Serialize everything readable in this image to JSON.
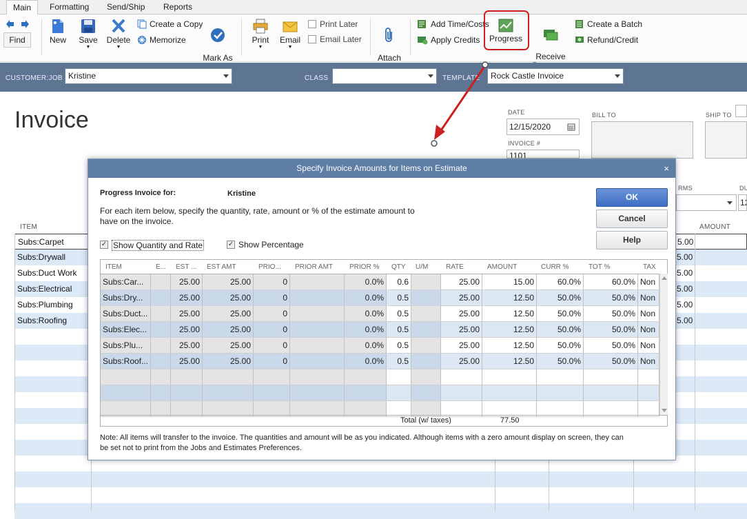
{
  "tabs": [
    "Main",
    "Formatting",
    "Send/Ship",
    "Reports"
  ],
  "ribbon": {
    "find": "Find",
    "new": "New",
    "save": "Save",
    "delete": "Delete",
    "create_copy": "Create a Copy",
    "memorize": "Memorize",
    "mark_as_pending": "Mark As\nPending",
    "print": "Print",
    "email": "Email",
    "print_later": "Print Later",
    "email_later": "Email Later",
    "attach_file": "Attach\nFile",
    "add_time_costs": "Add Time/Costs",
    "apply_credits": "Apply Credits",
    "progress": "Progress",
    "receive_payments": "Receive\nPayments",
    "create_batch": "Create a Batch",
    "refund_credit": "Refund/Credit"
  },
  "header": {
    "customer_job_label": "CUSTOMER:JOB",
    "customer_job_value": "Kristine",
    "class_label": "CLASS",
    "class_value": "",
    "template_label": "TEMPLATE",
    "template_value": "Rock Castle Invoice"
  },
  "invoice": {
    "title": "Invoice",
    "date_label": "DATE",
    "date_value": "12/15/2020",
    "invoice_no_label": "INVOICE #",
    "invoice_no_value": "1101",
    "bill_to_label": "BILL TO",
    "ship_to_label": "SHIP TO",
    "terms_label": "RMS",
    "due_label": "DU",
    "due_value": "12",
    "item_col": "ITEM",
    "amount_col": "AMOUNT",
    "lines": [
      {
        "item": "Subs:Carpet",
        "amount": "5.00"
      },
      {
        "item": "Subs:Drywall",
        "amount": "5.00"
      },
      {
        "item": "Subs:Duct Work",
        "amount": "5.00"
      },
      {
        "item": "Subs:Electrical",
        "amount": "5.00"
      },
      {
        "item": "Subs:Plumbing",
        "amount": "5.00"
      },
      {
        "item": "Subs:Roofing",
        "amount": "5.00"
      }
    ]
  },
  "dialog": {
    "title": "Specify Invoice Amounts for Items on Estimate",
    "progress_for_label": "Progress Invoice for:",
    "customer": "Kristine",
    "instructions": "For each item below, specify the quantity, rate, amount or % of the estimate amount to have on the invoice.",
    "show_qty_rate": "Show Quantity and Rate",
    "show_pct": "Show Percentage",
    "ok": "OK",
    "cancel": "Cancel",
    "help": "Help",
    "columns": [
      "ITEM",
      "E...",
      "EST ...",
      "EST AMT",
      "PRIO...",
      "PRIOR AMT",
      "PRIOR %",
      "QTY",
      "U/M",
      "RATE",
      "AMOUNT",
      "CURR %",
      "TOT %",
      "TAX"
    ],
    "rows": [
      {
        "item": "Subs:Car...",
        "est_qty": "25.00",
        "est_amt": "25.00",
        "prior_qty": "0",
        "prior_pct": "0.0%",
        "qty": "0.6",
        "rate": "25.00",
        "amount": "15.00",
        "curr_pct": "60.0%",
        "tot_pct": "60.0%",
        "tax": "Non"
      },
      {
        "item": "Subs:Dry...",
        "est_qty": "25.00",
        "est_amt": "25.00",
        "prior_qty": "0",
        "prior_pct": "0.0%",
        "qty": "0.5",
        "rate": "25.00",
        "amount": "12.50",
        "curr_pct": "50.0%",
        "tot_pct": "50.0%",
        "tax": "Non"
      },
      {
        "item": "Subs:Duct...",
        "est_qty": "25.00",
        "est_amt": "25.00",
        "prior_qty": "0",
        "prior_pct": "0.0%",
        "qty": "0.5",
        "rate": "25.00",
        "amount": "12.50",
        "curr_pct": "50.0%",
        "tot_pct": "50.0%",
        "tax": "Non"
      },
      {
        "item": "Subs:Elec...",
        "est_qty": "25.00",
        "est_amt": "25.00",
        "prior_qty": "0",
        "prior_pct": "0.0%",
        "qty": "0.5",
        "rate": "25.00",
        "amount": "12.50",
        "curr_pct": "50.0%",
        "tot_pct": "50.0%",
        "tax": "Non"
      },
      {
        "item": "Subs:Plu...",
        "est_qty": "25.00",
        "est_amt": "25.00",
        "prior_qty": "0",
        "prior_pct": "0.0%",
        "qty": "0.5",
        "rate": "25.00",
        "amount": "12.50",
        "curr_pct": "50.0%",
        "tot_pct": "50.0%",
        "tax": "Non"
      },
      {
        "item": "Subs:Roof...",
        "est_qty": "25.00",
        "est_amt": "25.00",
        "prior_qty": "0",
        "prior_pct": "0.0%",
        "qty": "0.5",
        "rate": "25.00",
        "amount": "12.50",
        "curr_pct": "50.0%",
        "tot_pct": "50.0%",
        "tax": "Non"
      }
    ],
    "total_label": "Total (w/ taxes)",
    "total_value": "77.50",
    "note": "Note: All items will transfer to the invoice. The quantities and amount will be as you indicated. Although items with a zero amount display on screen, they can be set not to print from the Jobs and Estimates Preferences."
  },
  "colors": {
    "header_bar": "#5e7591",
    "dialog_title": "#5f7ea6",
    "highlight_red": "#cc1f1f",
    "row_alt": "#dce9f7"
  }
}
